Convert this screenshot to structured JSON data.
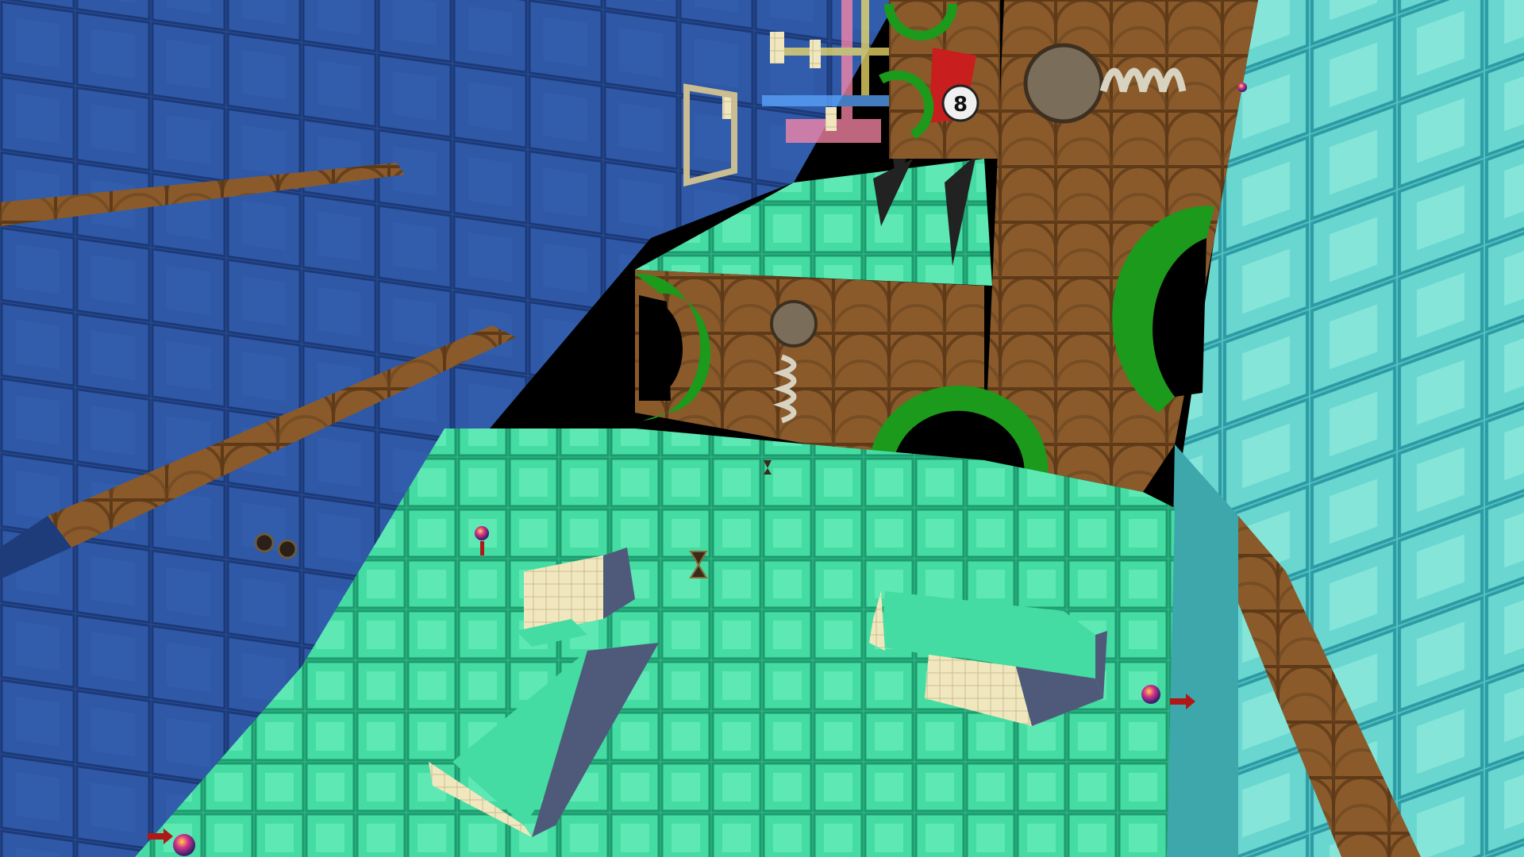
{
  "scene": {
    "title": "",
    "hud_text": "",
    "floor_number_glyph": "8",
    "palette": {
      "left_wall": "#2a4f96",
      "left_wall_dark": "#1e3c7a",
      "right_wall": "#55c9c9",
      "right_wall_light": "#8fe6df",
      "floor": "#3fd9a0",
      "floor_light": "#6ff0c0",
      "wood": "#8a5a2b",
      "wood_dark": "#5e3a18",
      "green_arch": "#1b9a1b",
      "cream_block": "#f1e7bf",
      "spring": "#d8d2c0",
      "arrow_red": "#b01818"
    },
    "objects": [
      "left-wall",
      "right-wall",
      "floor",
      "wooden-block",
      "green-arch",
      "spring-launcher",
      "raised-blocks",
      "marble-ball",
      "arrow-marker",
      "laser-beams",
      "hourglass-pickup",
      "ramp-slope"
    ]
  }
}
